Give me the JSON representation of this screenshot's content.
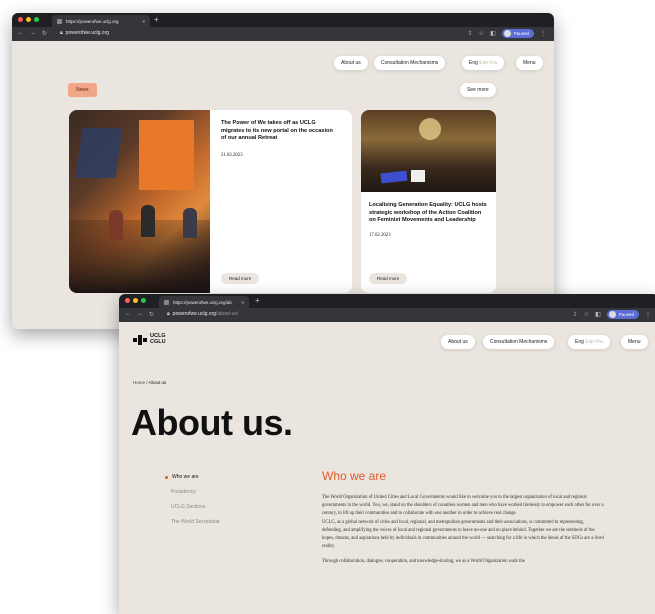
{
  "win1": {
    "tab_title": "https://powerofwe.uclg.org",
    "url": "powerofwe.uclg.org",
    "paused": "Paused",
    "nav": {
      "about": "About us",
      "consultation": "Consultation Mechanisms",
      "lang_eng": "Eng",
      "lang_esp": "Esp",
      "lang_fra": "Fra",
      "menu": "Menu"
    },
    "news_label": "News",
    "see_more": "See more",
    "cards": [
      {
        "title": "The Power of We takes off as UCLG migrates to its new portal on the occasion of our annual Retreat",
        "date": "21.02.2023",
        "read_more": "Read more"
      },
      {
        "title": "Localising Generation Equality: UCLG hosts strategic workshop of the Action Coalition on Feminist Movements and Leadership",
        "date": "17.02.2023",
        "read_more": "Read more"
      }
    ]
  },
  "win2": {
    "tab_title": "https://powerofwe.uclg.org/ab",
    "url_host": "powerofwe.uclg.org",
    "url_path": "/about-us/",
    "paused": "Paused",
    "logo_line1": "UCLG",
    "logo_line2": "CGLU",
    "nav": {
      "about": "About us",
      "consultation": "Consultation Mechanisms",
      "lang_eng": "Eng",
      "lang_esp": "Esp",
      "lang_fra": "Fra",
      "menu": "Menu"
    },
    "breadcrumb_home": "Home",
    "breadcrumb_sep": " / ",
    "breadcrumb_current": "About us",
    "page_title": "About us.",
    "sidenav": [
      "Who we are",
      "Presidency",
      "UCLG Sections",
      "The World Secretariat"
    ],
    "section_title": "Who we are",
    "paragraph1": "The World Organization of United Cities and Local Governments would like to welcome you to the largest organization of local and regional governments in the world. You, we, stand on the shoulders of countless women and men who have worked tirelessly to empower each other for over a century, to lift up their communities and to collaborate with one another in order to achieve real change.",
    "paragraph2": "UCLG, as a global network of cities and local, regional, and metropolitan governments and their associations, is committed to representing, defending, and amplifying the voices of local and regional governments to leave no-one and no place behind. Together we are the sentinels of the hopes, dreams, and aspirations held by individuals in communities around the world — searching for a life in which the ideals of the SDGs are a lived reality.",
    "paragraph3": "Through collaboration, dialogue, cooperation, and knowledge-sharing, we as a World Organization walk the"
  },
  "colors": {
    "accent": "#e2592b",
    "news_badge": "#f2a688",
    "page_bg": "#ebe5df",
    "chrome_dark": "#1f2023",
    "chrome_bar": "#35363a"
  }
}
